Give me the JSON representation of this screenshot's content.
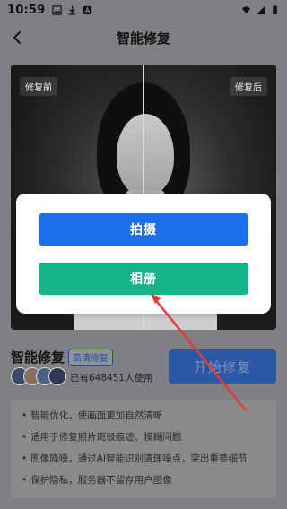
{
  "status": {
    "time": "10:59"
  },
  "header": {
    "title": "智能修复"
  },
  "photo": {
    "tag_before": "修复前",
    "tag_after": "修复后"
  },
  "dialog": {
    "shoot_label": "拍摄",
    "album_label": "相册"
  },
  "feature": {
    "name": "智能修复",
    "badge": "高清修复",
    "used_text": "已有648451人使用"
  },
  "start": {
    "label": "开始修复"
  },
  "tips": [
    "智能优化，使画面更加自然清晰",
    "适用于修复照片斑驳痕迹、模糊问题",
    "图像降噪，通过AI智能识别清理噪点，突出重要细节",
    "保护隐私，服务器不留存用户图像"
  ],
  "colors": {
    "primary": "#1b6fe8",
    "green": "#16b38a",
    "badge": "#1a4fb0",
    "arrow": "#e23b3b"
  }
}
